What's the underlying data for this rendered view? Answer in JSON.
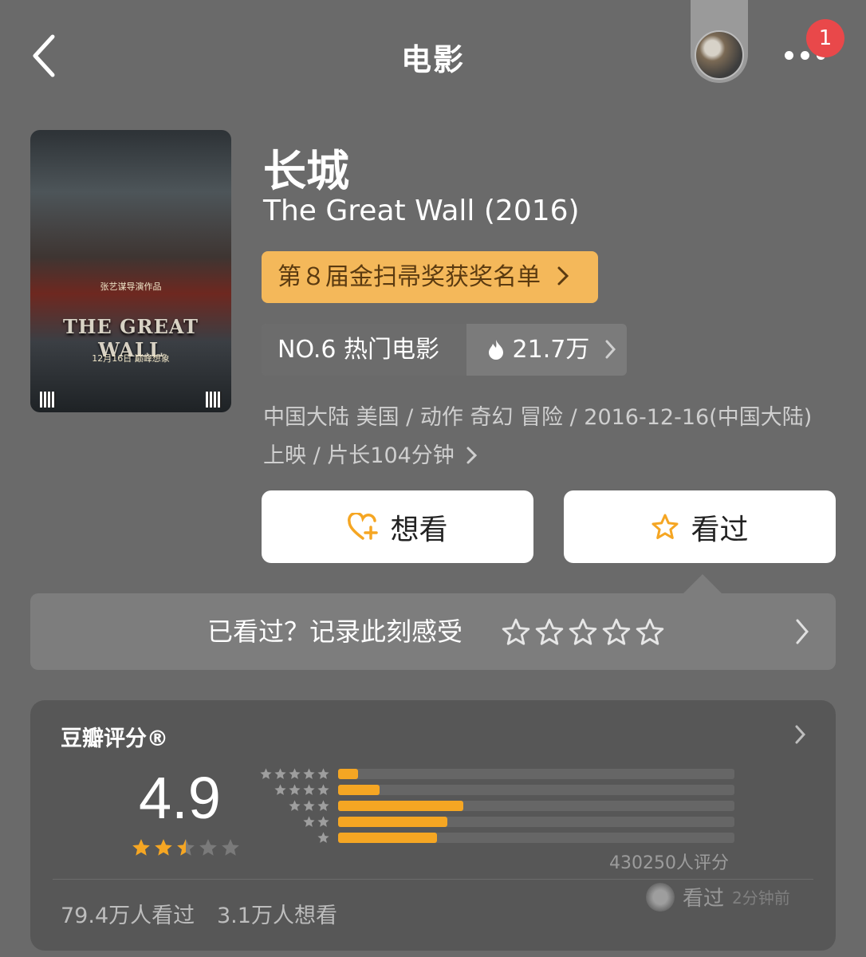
{
  "nav": {
    "title": "电影",
    "notification_count": "1"
  },
  "poster": {
    "title_art": "THE GREAT WALL",
    "credit": "张艺谋导演作品",
    "release_line": "12月16日 巅峰想象"
  },
  "movie": {
    "title_cn": "长城",
    "title_en": "The Great Wall (2016)",
    "award": "第８届金扫帚奖获奖名单",
    "rank_label": "NO.6 热门电影",
    "heat": "21.7万",
    "info_line1": "中国大陆 美国 / 动作 奇幻 冒险 / 2016-12-16(中国大陆)",
    "info_line2": "上映 / 片长104分钟"
  },
  "actions": {
    "want_label": "想看",
    "seen_label": "看过"
  },
  "rate_prompt": {
    "text": "已看过？记录此刻感受",
    "star_count": 5
  },
  "douban": {
    "title": "豆瓣评分®",
    "score": "4.9",
    "score_stars": 2.5,
    "distribution_percent": {
      "5": 5,
      "4": 10.5,
      "3": 31.5,
      "2": 27.5,
      "1": 25
    },
    "rating_count": "430250人评分",
    "watched": "79.4万人看过",
    "wishes": "3.1万人想看",
    "recent_action": "看过",
    "recent_time": "2分钟前"
  },
  "colors": {
    "background": "#6a6a6a",
    "award_bg": "#f4b85a",
    "accent": "#f5a623",
    "badge": "#e9484a"
  }
}
